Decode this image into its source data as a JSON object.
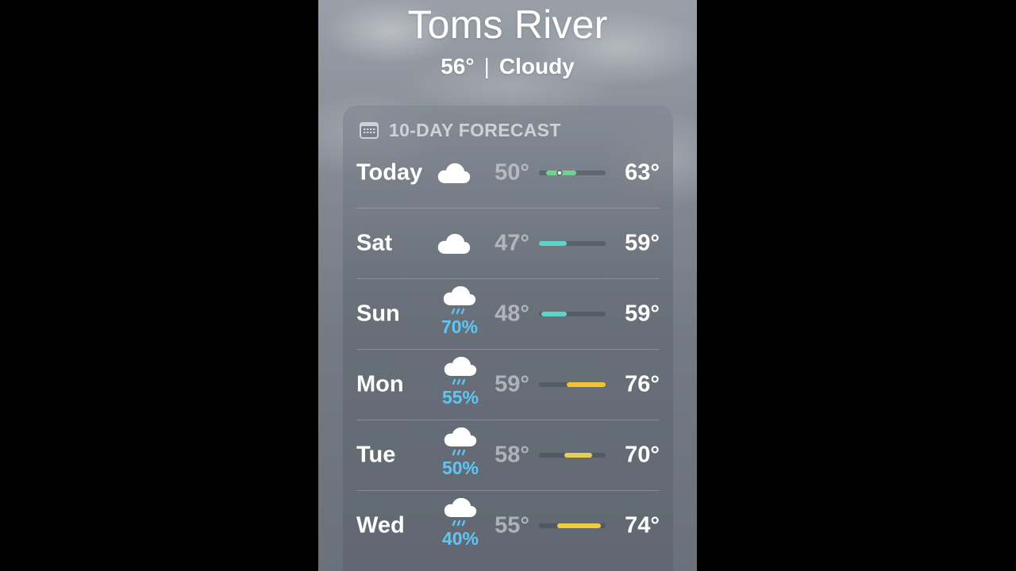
{
  "location": {
    "city": "Toms River",
    "current_temp": "56°",
    "separator": "|",
    "condition": "Cloudy"
  },
  "forecast": {
    "title": "10-DAY FORECAST",
    "title_icon": "calendar-icon",
    "range_min": 47,
    "range_max": 76,
    "days": [
      {
        "day": "Today",
        "icon": "cloud-icon",
        "precip": "",
        "low": "50°",
        "high": "63°",
        "low_val": 50,
        "high_val": 63,
        "bar_color": "#6fd38e",
        "now": 56
      },
      {
        "day": "Sat",
        "icon": "cloud-icon",
        "precip": "",
        "low": "47°",
        "high": "59°",
        "low_val": 47,
        "high_val": 59,
        "bar_color": "#5fd3c6"
      },
      {
        "day": "Sun",
        "icon": "cloud-rain-icon",
        "precip": "70%",
        "low": "48°",
        "high": "59°",
        "low_val": 48,
        "high_val": 59,
        "bar_color": "#5fd3c6"
      },
      {
        "day": "Mon",
        "icon": "cloud-rain-icon",
        "precip": "55%",
        "low": "59°",
        "high": "76°",
        "low_val": 59,
        "high_val": 76,
        "bar_color": "#f2c230"
      },
      {
        "day": "Tue",
        "icon": "cloud-rain-icon",
        "precip": "50%",
        "low": "58°",
        "high": "70°",
        "low_val": 58,
        "high_val": 70,
        "bar_color": "#e7cf55"
      },
      {
        "day": "Wed",
        "icon": "cloud-rain-icon",
        "precip": "40%",
        "low": "55°",
        "high": "74°",
        "low_val": 55,
        "high_val": 74,
        "bar_color": "#f0cc3e"
      }
    ]
  }
}
